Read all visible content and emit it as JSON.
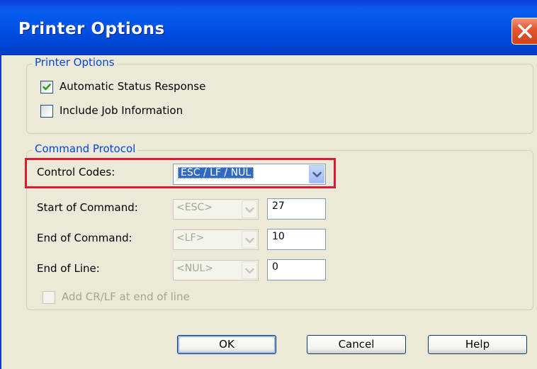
{
  "window": {
    "title": "Printer Options"
  },
  "printer_options": {
    "group_label": "Printer Options",
    "automatic_status_response": {
      "label": "Automatic Status Response",
      "checked": true
    },
    "include_job_information": {
      "label": "Include Job Information",
      "checked": false
    }
  },
  "command_protocol": {
    "group_label": "Command Protocol",
    "control_codes": {
      "label": "Control Codes:",
      "value": "ESC / LF / NUL"
    },
    "start_of_command": {
      "label": "Start of Command:",
      "select": "<ESC>",
      "code": "27"
    },
    "end_of_command": {
      "label": "End of Command:",
      "select": "<LF>",
      "code": "10"
    },
    "end_of_line": {
      "label": "End of Line:",
      "select": "<NUL>",
      "code": "0"
    },
    "add_crlf": {
      "label": "Add CR/LF at end of line",
      "checked": false,
      "enabled": false
    }
  },
  "buttons": {
    "ok": "OK",
    "cancel": "Cancel",
    "help": "Help"
  },
  "colors": {
    "titlebar": "#0255e8",
    "dialog_bg": "#ece9d8",
    "group_label": "#0046d5",
    "highlight": "#e0182a",
    "selection": "#316ac5"
  },
  "icons": {
    "close": "close-x-icon",
    "check": "checkmark-icon",
    "dropdown": "chevron-down-icon"
  }
}
